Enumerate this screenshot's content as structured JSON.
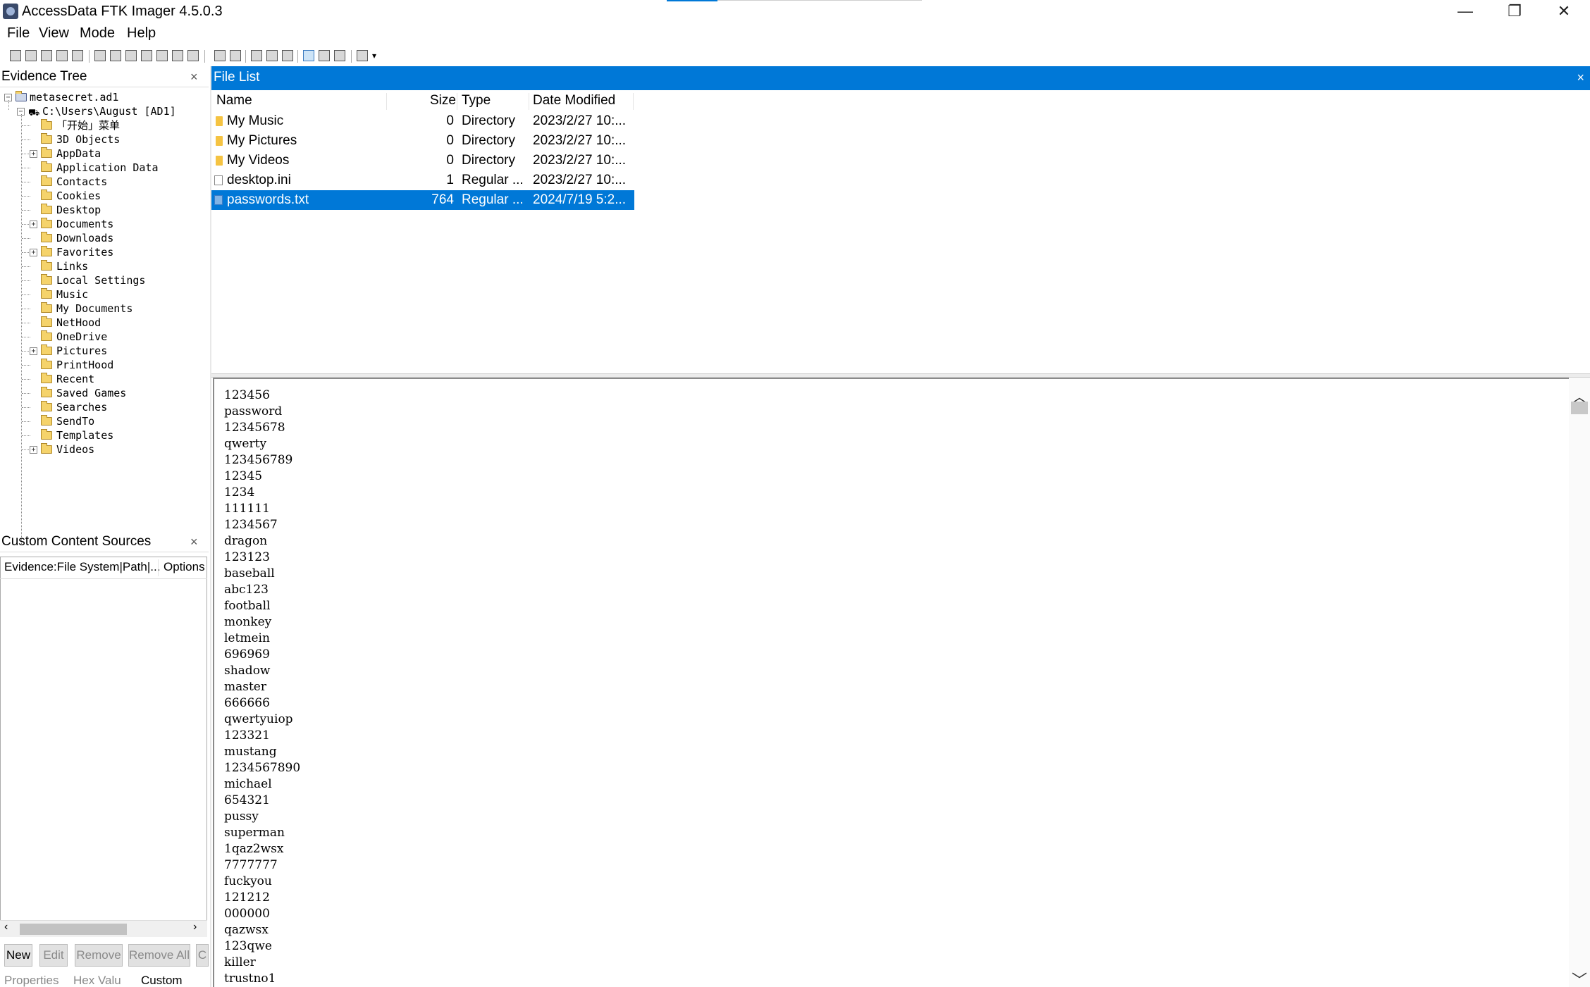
{
  "window": {
    "title": "AccessData FTK Imager 4.5.0.3",
    "minimize": "—",
    "restore": "❐",
    "close": "✕"
  },
  "menu": [
    "File",
    "View",
    "Mode",
    "Help"
  ],
  "evidence_tree": {
    "title": "Evidence Tree",
    "close": "×",
    "root": "metasecret.ad1",
    "path": "C:\\Users\\August [AD1]",
    "items": [
      {
        "label": "「开始」菜单",
        "expandable": false
      },
      {
        "label": "3D Objects",
        "expandable": false
      },
      {
        "label": "AppData",
        "expandable": true
      },
      {
        "label": "Application Data",
        "expandable": false
      },
      {
        "label": "Contacts",
        "expandable": false
      },
      {
        "label": "Cookies",
        "expandable": false
      },
      {
        "label": "Desktop",
        "expandable": false
      },
      {
        "label": "Documents",
        "expandable": true
      },
      {
        "label": "Downloads",
        "expandable": false
      },
      {
        "label": "Favorites",
        "expandable": true
      },
      {
        "label": "Links",
        "expandable": false
      },
      {
        "label": "Local Settings",
        "expandable": false
      },
      {
        "label": "Music",
        "expandable": false
      },
      {
        "label": "My Documents",
        "expandable": false
      },
      {
        "label": "NetHood",
        "expandable": false
      },
      {
        "label": "OneDrive",
        "expandable": false
      },
      {
        "label": "Pictures",
        "expandable": true
      },
      {
        "label": "PrintHood",
        "expandable": false
      },
      {
        "label": "Recent",
        "expandable": false
      },
      {
        "label": "Saved Games",
        "expandable": false
      },
      {
        "label": "Searches",
        "expandable": false
      },
      {
        "label": "SendTo",
        "expandable": false
      },
      {
        "label": "Templates",
        "expandable": false
      },
      {
        "label": "Videos",
        "expandable": true
      }
    ]
  },
  "custom_sources": {
    "title": "Custom Content Sources",
    "close": "×",
    "col_evidence": "Evidence:File System|Path|...",
    "col_options": "Options",
    "buttons": {
      "new": "New",
      "edit": "Edit",
      "remove": "Remove",
      "remove_all": "Remove All",
      "more": "C"
    },
    "tabs": [
      "Properties",
      "Hex Valu",
      "Custom"
    ]
  },
  "file_list": {
    "title": "File List",
    "close": "×",
    "columns": {
      "name": "Name",
      "size": "Size",
      "type": "Type",
      "date": "Date Modified"
    },
    "rows": [
      {
        "name": "My Music",
        "size": "0",
        "type": "Directory",
        "date": "2023/2/27 10:...",
        "icon": "folder-icon",
        "selected": false
      },
      {
        "name": "My Pictures",
        "size": "0",
        "type": "Directory",
        "date": "2023/2/27 10:...",
        "icon": "folder-icon",
        "selected": false
      },
      {
        "name": "My Videos",
        "size": "0",
        "type": "Directory",
        "date": "2023/2/27 10:...",
        "icon": "folder-icon",
        "selected": false
      },
      {
        "name": "desktop.ini",
        "size": "1",
        "type": "Regular ...",
        "date": "2023/2/27 10:...",
        "icon": "file-icon",
        "selected": false
      },
      {
        "name": "passwords.txt",
        "size": "764",
        "type": "Regular ...",
        "date": "2024/7/19 5:2...",
        "icon": "text-file-icon",
        "selected": true
      }
    ]
  },
  "viewer": {
    "lines": [
      "123456",
      "password",
      "12345678",
      "qwerty",
      "123456789",
      "12345",
      "1234",
      "111111",
      "1234567",
      "dragon",
      "123123",
      "baseball",
      "abc123",
      "football",
      "monkey",
      "letmein",
      "696969",
      "shadow",
      "master",
      "666666",
      "qwertyuiop",
      "123321",
      "mustang",
      "1234567890",
      "michael",
      "654321",
      "pussy",
      "superman",
      "1qaz2wsx",
      "7777777",
      "fuckyou",
      "121212",
      "000000",
      "qazwsx",
      "123qwe",
      "killer",
      "trustno1"
    ]
  },
  "colors": {
    "accent": "#0078d7",
    "selection_text": "#ffffff"
  }
}
